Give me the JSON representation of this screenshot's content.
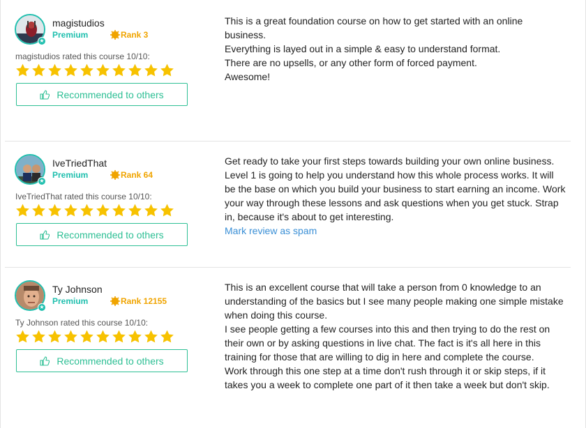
{
  "colors": {
    "accent_teal": "#1fbfae",
    "rank_orange": "#f0a400",
    "star_yellow": "#f7c200",
    "button_green": "#2dbf94",
    "link_blue": "#3a8fd6"
  },
  "reviews": [
    {
      "username": "magistudios",
      "membership": "Premium",
      "rank": "Rank 3",
      "rated_text": "magistudios rated this course 10/10:",
      "rating": 10,
      "recommend_label": "Recommended to others",
      "paragraphs": [
        "This is a great foundation course on how to get started with an online business.",
        "Everything is layed out in a simple & easy to understand format.\nThere are no upsells, or any other form of forced payment.",
        "Awesome!"
      ]
    },
    {
      "username": "IveTriedThat",
      "membership": "Premium",
      "rank": "Rank 64",
      "rated_text": "IveTriedThat rated this course 10/10:",
      "rating": 10,
      "recommend_label": "Recommended to others",
      "paragraphs": [
        "Get ready to take your first steps towards building your own online business. Level 1 is going to help you understand how this whole process works. It will be the base on which you build your business to start earning an income. Work your way through these lessons and ask questions when you get stuck. Strap in, because it's about to get interesting."
      ],
      "spam_link": "Mark review as spam"
    },
    {
      "username": "Ty Johnson",
      "membership": "Premium",
      "rank": "Rank 12155",
      "rated_text": "Ty Johnson rated this course 10/10:",
      "rating": 10,
      "recommend_label": "Recommended to others",
      "paragraphs": [
        "This is an excellent course that will take a person from 0 knowledge to an understanding of the basics but I see many people making one simple mistake when doing this course.",
        "I see people getting a few courses into this and then trying to do the rest on their own or by asking questions in live chat. The fact is it's all here in this training for those that are willing to dig in here and complete the course.",
        "Work through this one step at a time don't rush through it or skip steps, if it takes you a week to complete one part of it then take a week but don't skip."
      ]
    }
  ]
}
